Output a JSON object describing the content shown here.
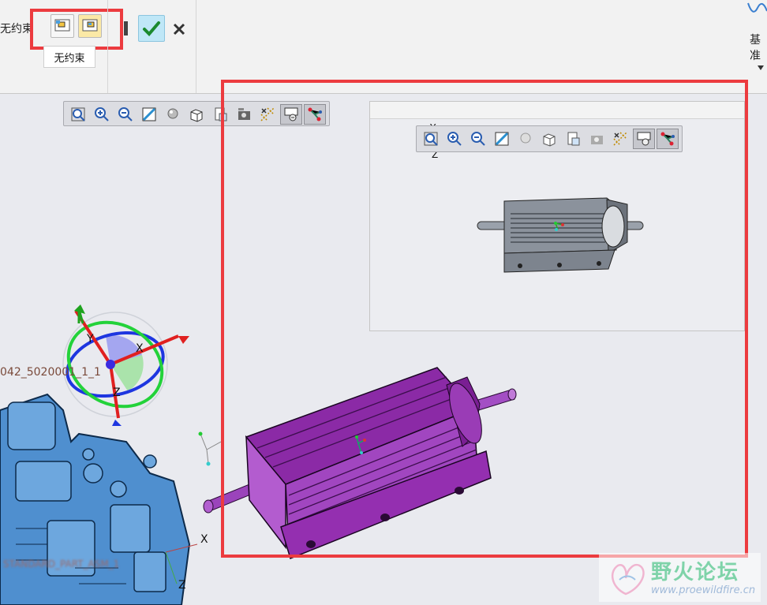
{
  "ribbon": {
    "constraint_label": "无约束",
    "right_label": "基准",
    "tooltip": "无约束"
  },
  "viewport": {
    "part_name": "042_5020001_1_1",
    "blurred_caption": "STANDARD_PART_ASM_1",
    "axis_x": "X",
    "axis_y": "Y",
    "axis_z": "Z",
    "axis_x2": "X",
    "axis_z2": "Z"
  },
  "preview": {
    "axis_y": "Y",
    "axis_z": "Z"
  },
  "toolbar_icons": [
    "zoom-fit-icon",
    "zoom-in-icon",
    "zoom-out-icon",
    "repaint-icon",
    "display-style-icon",
    "saved-views-icon",
    "named-view-icon",
    "view-manager-icon",
    "datum-display-icon",
    "spin-center-icon",
    "annotation-display-icon"
  ],
  "colors": {
    "accent_highlight": "#ec3b3f",
    "part_purple": "#8b2aa6",
    "part_grey": "#8b929c",
    "assembly_blue": "#4f8fcf"
  },
  "watermark": {
    "title": "野火论坛",
    "url": "www.proewildfire.cn"
  }
}
